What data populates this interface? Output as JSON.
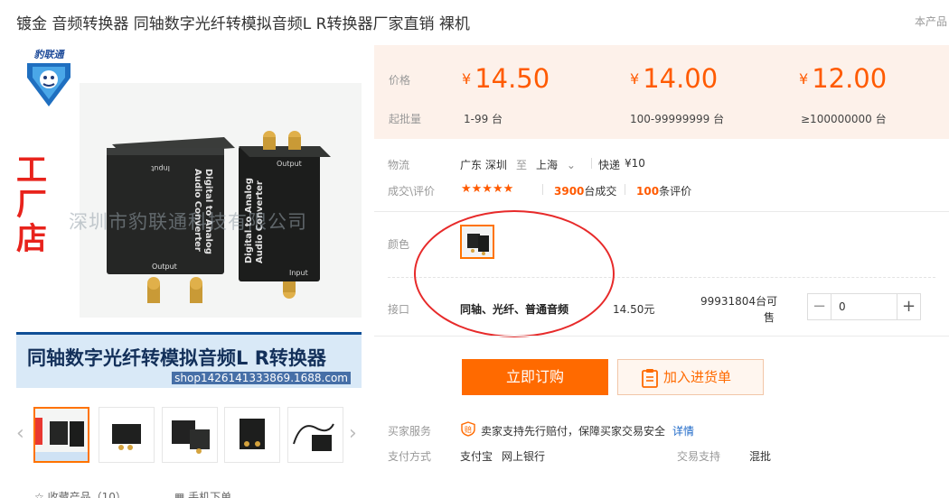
{
  "header": {
    "title": "镀金 音频转换器 同轴数字光纤转模拟音频L R转换器厂家直销 裸机",
    "right_text": "本产品"
  },
  "gallery": {
    "logo_text": "豹联通",
    "side_text": "工厂店",
    "watermark": "深圳市豹联通科技有限公司",
    "device_label_1": "Digital to Analog",
    "device_label_2": "Audio Converter",
    "device_input": "Input",
    "device_output": "Output",
    "banner_text": "同轴数字光纤转模拟音频L R转换器",
    "banner_sub": "shop1426141333869.1688.com",
    "prev_icon": "chevron-left-icon",
    "next_icon": "chevron-right-icon"
  },
  "bottom": {
    "favorite": "收藏产品（10）",
    "phone_order": "手机下单"
  },
  "pricing": {
    "price_label": "价格",
    "moq_label": "起批量",
    "tiers": [
      {
        "price": "14.50",
        "range": "1-99 台"
      },
      {
        "price": "14.00",
        "range": "100-99999999 台"
      },
      {
        "price": "12.00",
        "range": "≥100000000 台"
      }
    ],
    "currency": "¥"
  },
  "logistics": {
    "label": "物流",
    "from": "广东 深圳",
    "to_word": "至",
    "dest": "上海",
    "express": "快递",
    "express_fee": "¥10"
  },
  "reviews": {
    "label": "成交\\评价",
    "stars": "★★★★★",
    "deals_count": "3900",
    "deals_unit": "台成交",
    "reviews_count": "100",
    "reviews_unit": "条评价"
  },
  "color": {
    "label": "颜色"
  },
  "interface": {
    "label": "接口",
    "value": "同轴、光纤、普通音频",
    "price": "14.50元",
    "stock_line1": "99931804台可",
    "stock_line2": "售",
    "quantity": "0",
    "minus": "−",
    "plus": "+"
  },
  "actions": {
    "buy": "立即订购",
    "cart": "加入进货单"
  },
  "service": {
    "label": "买家服务",
    "text": "卖家支持先行赔付，保障买家交易安全",
    "detail_link": "详情",
    "badge": "赔"
  },
  "payment": {
    "label": "支付方式",
    "methods": [
      "支付宝",
      "网上银行"
    ],
    "trade_support_label": "交易支持",
    "trade_support_value": "混批"
  },
  "colors": {
    "accent": "#ff6a00",
    "price": "#ff5a00",
    "price_bg": "#fdf1ea",
    "annotation": "#e72a2a",
    "link": "#1e69c8"
  }
}
